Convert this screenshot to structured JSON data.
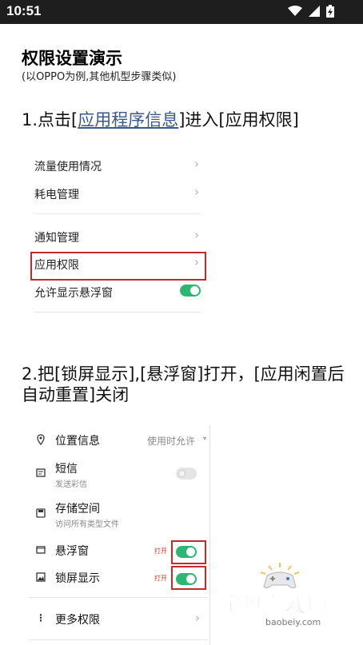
{
  "status_bar": {
    "time": "10:51",
    "icons": [
      "wifi-icon",
      "signal-icon",
      "battery-charging-icon"
    ]
  },
  "page": {
    "title": "权限设置演示",
    "subtitle": "(以OPPO为例,其他机型步骤类似)"
  },
  "step1": {
    "prefix": "1.点击[",
    "link": "应用程序信息",
    "suffix": "]进入[应用权限]",
    "items": [
      {
        "label": "流量使用情况"
      },
      {
        "label": "耗电管理"
      },
      {
        "label": "通知管理"
      },
      {
        "label": "应用权限"
      },
      {
        "label": "允许显示悬浮窗",
        "toggle": "on"
      }
    ]
  },
  "step2": {
    "heading": "2.把[锁屏显示],[悬浮窗]打开，[应用闲置后自动重置]关闭",
    "items": [
      {
        "icon": "location-icon",
        "title": "位置信息",
        "value": "使用时允许"
      },
      {
        "icon": "message-icon",
        "title": "短信",
        "subtitle": "发送彩信",
        "toggle": "off"
      },
      {
        "icon": "storage-icon",
        "title": "存储空间",
        "subtitle": "访问所有类型文件"
      },
      {
        "icon": "floating-window-icon",
        "title": "悬浮窗",
        "tag": "打开",
        "toggle": "on"
      },
      {
        "icon": "lockscreen-icon",
        "title": "锁屏显示",
        "tag": "打开",
        "toggle": "on"
      },
      {
        "icon": "more-vertical-icon",
        "title": "更多权限"
      }
    ]
  },
  "watermark": {
    "text": "宝贝游戏网",
    "url": "baobeiy.com"
  },
  "colors": {
    "toggle_on": "#2bb673",
    "highlight": "#c52a2a",
    "link": "#3a5a8a",
    "watermark": "#3b79c9"
  }
}
